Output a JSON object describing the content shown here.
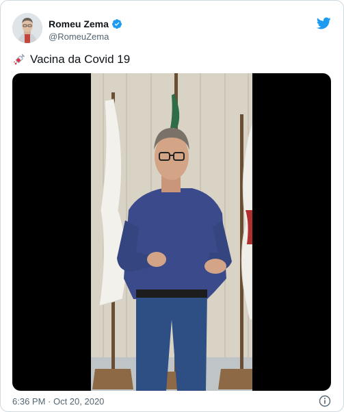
{
  "author": {
    "name": "Romeu Zema",
    "handle": "@RomeuZema",
    "verified": true
  },
  "tweet": {
    "emoji_icon": "syringe-icon",
    "text": "Vacina da Covid 19"
  },
  "media": {
    "type": "video"
  },
  "meta": {
    "timestamp": "6:36 PM · Oct 20, 2020"
  },
  "colors": {
    "twitter_blue": "#1d9bf0",
    "text_primary": "#0f1419",
    "text_secondary": "#536471",
    "border": "#cfd9de"
  }
}
